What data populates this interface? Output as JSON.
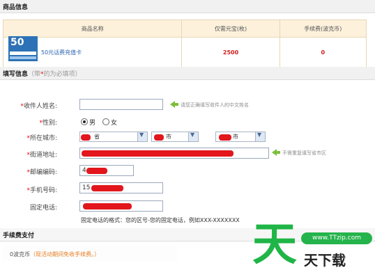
{
  "goods_section": {
    "title": "商品信息"
  },
  "goods_table": {
    "headers": [
      "商品名称",
      "仅需元宝(枚)",
      "手续费(波克币)"
    ],
    "row": {
      "name": "50元话费充值卡",
      "price": "2500",
      "fee": "0"
    },
    "thumb_text": "50"
  },
  "fill_section": {
    "title": "填写信息",
    "note_pre": "（带",
    "note_star": "*",
    "note_post": "的为必填项）"
  },
  "form": {
    "name_label": "收件人姓名:",
    "name_hint": "请您正确填写收件人的中文姓名",
    "gender_label": "性别:",
    "gender_male": "男",
    "gender_female": "女",
    "city_label": "所在城市:",
    "province_value": "省",
    "city_value": "市",
    "district_value": "市",
    "street_label": "街道地址:",
    "street_hint": "不需重复填写省市区",
    "zip_label": "邮编编码:",
    "zip_value": "4",
    "mobile_label": "手机号码:",
    "mobile_value": "15",
    "phone_label": "固定电话:",
    "phone_format": "固定电话的格式：您的区号-您的固定电话，例如XXX-XXXXXXX"
  },
  "fee_section": {
    "title": "手续费支付",
    "fee_text": "0波克币",
    "fee_note": "（现活动期间免收手续费。）"
  },
  "watermark": {
    "big": "天",
    "url": "www.TTzip.com",
    "sub": "天下载"
  },
  "colors": {
    "accent_green": "#1fb547",
    "required_red": "#e00000",
    "link_blue": "#2a62b0"
  }
}
